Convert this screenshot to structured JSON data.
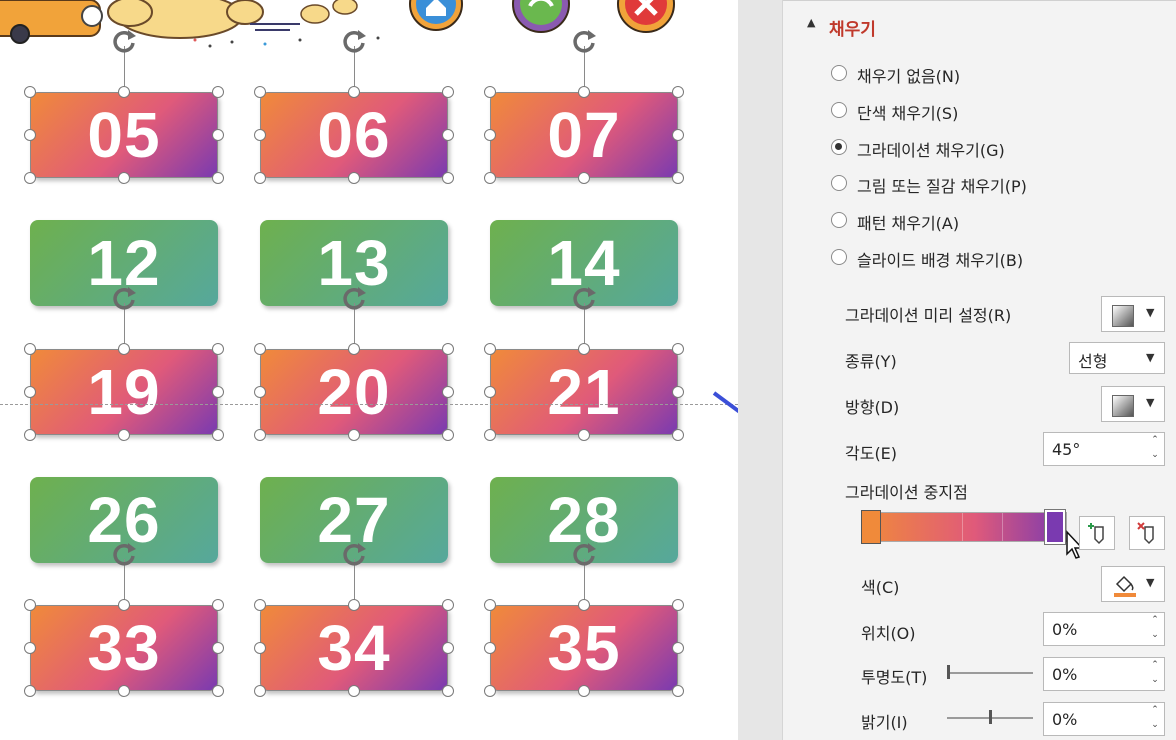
{
  "slide": {
    "rows": [
      {
        "style": "grad",
        "selected": true,
        "labels": [
          "05",
          "06",
          "07"
        ]
      },
      {
        "style": "green",
        "selected": false,
        "labels": [
          "12",
          "13",
          "14"
        ]
      },
      {
        "style": "grad",
        "selected": true,
        "labels": [
          "19",
          "20",
          "21"
        ]
      },
      {
        "style": "green",
        "selected": false,
        "labels": [
          "26",
          "27",
          "28"
        ]
      },
      {
        "style": "grad",
        "selected": true,
        "labels": [
          "33",
          "34",
          "35"
        ]
      }
    ],
    "colors": {
      "grad_start": "#f08a3a",
      "grad_mid": "#e05a7a",
      "grad_end": "#7a3ab0",
      "green_start": "#6eb04e",
      "green_end": "#56a89c",
      "arrow": "#3b4fd8"
    }
  },
  "panel": {
    "section_title": "채우기",
    "fill_options": [
      {
        "label": "채우기 없음(N)",
        "selected": false
      },
      {
        "label": "단색 채우기(S)",
        "selected": false
      },
      {
        "label": "그라데이션 채우기(G)",
        "selected": true
      },
      {
        "label": "그림 또는 질감 채우기(P)",
        "selected": false
      },
      {
        "label": "패턴 채우기(A)",
        "selected": false
      },
      {
        "label": "슬라이드 배경 채우기(B)",
        "selected": false
      }
    ],
    "preset_label": "그라데이션 미리 설정(R)",
    "type_label": "종류(Y)",
    "type_value": "선형",
    "direction_label": "방향(D)",
    "angle_label": "각도(E)",
    "angle_value": "45°",
    "stops_label": "그라데이션 중지점",
    "color_label": "색(C)",
    "position_label": "위치(O)",
    "position_value": "0%",
    "transparency_label": "투명도(T)",
    "transparency_value": "0%",
    "transparency_level": 0,
    "brightness_label": "밝기(I)",
    "brightness_value": "0%",
    "brightness_level": 0.5,
    "accent_color": "#c0392b",
    "stop_colors": [
      "#f08a3a",
      "#7a3ab0"
    ]
  }
}
